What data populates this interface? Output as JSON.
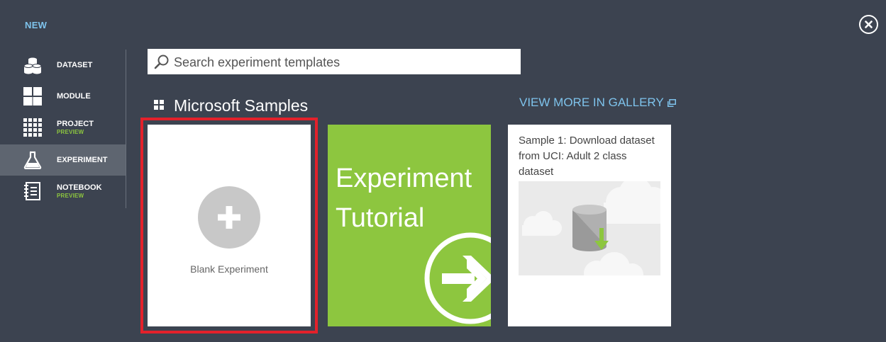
{
  "header": {
    "title": "NEW",
    "close_icon": "close-icon"
  },
  "sidebar": {
    "items": [
      {
        "label": "DATASET",
        "icon": "database-icon"
      },
      {
        "label": "MODULE",
        "icon": "module-grid-icon"
      },
      {
        "label": "PROJECT",
        "sublabel": "PREVIEW",
        "icon": "project-grid-icon"
      },
      {
        "label": "EXPERIMENT",
        "icon": "flask-icon",
        "active": true
      },
      {
        "label": "NOTEBOOK",
        "sublabel": "PREVIEW",
        "icon": "notebook-icon"
      }
    ]
  },
  "search": {
    "placeholder": "Search experiment templates",
    "value": ""
  },
  "section": {
    "title": "Microsoft Samples",
    "gallery_link": "VIEW MORE IN GALLERY"
  },
  "tiles": {
    "blank": {
      "label": "Blank Experiment",
      "icon": "plus-icon"
    },
    "tutorial": {
      "title": "Experiment\nTutorial",
      "icon": "arrow-right-circle-icon"
    },
    "sample": {
      "title": "Sample 1: Download dataset from UCI: Adult 2 class dataset",
      "icon": "dataset-download-icon"
    }
  },
  "colors": {
    "background": "#3c4350",
    "accent_blue": "#7ec3ec",
    "accent_green": "#8dc63f",
    "highlight_red": "#e3212b",
    "active_nav": "#5e6570"
  }
}
